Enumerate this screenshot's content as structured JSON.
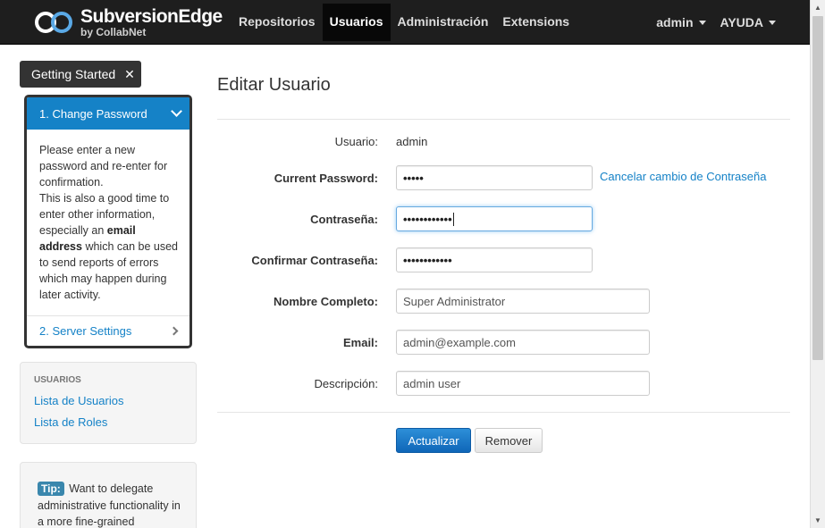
{
  "brand": {
    "title": "SubversionEdge",
    "subtitle": "by CollabNet"
  },
  "nav": {
    "links": [
      "Repositorios",
      "Usuarios",
      "Administración",
      "Extensions"
    ],
    "active": "Usuarios",
    "user_menu": "admin",
    "help_menu": "AYUDA"
  },
  "getting_started": {
    "button": "Getting Started",
    "close": "✕",
    "step1": "1. Change Password",
    "body_1": "Please enter a new password and re-enter for confirmation.",
    "body_2": "This is also a good time to enter other information, especially an",
    "body_bold": "email address",
    "body_3": "which can be used to send reports of errors which may happen during later activity.",
    "step2": "2. Server Settings"
  },
  "side_menu": {
    "heading": "USUARIOS",
    "items": [
      "Lista de Usuarios",
      "Lista de Roles"
    ]
  },
  "tip": {
    "label": "Tip:",
    "text": "Want to delegate administrative functionality in a more fine-grained"
  },
  "form": {
    "title": "Editar Usuario",
    "username_label": "Usuario:",
    "username_value": "admin",
    "current_password_label": "Current Password:",
    "current_password_value": "•••••",
    "cancel_link": "Cancelar cambio de Contraseña",
    "password_label": "Contraseña:",
    "password_value": "••••••••••••",
    "confirm_label": "Confirmar Contraseña:",
    "confirm_value": "••••••••••••",
    "fullname_label": "Nombre Completo:",
    "fullname_value": "Super Administrator",
    "email_label": "Email:",
    "email_value": "admin@example.com",
    "description_label": "Descripción:",
    "description_value": "admin user",
    "update_button": "Actualizar",
    "remove_button": "Remover"
  },
  "colors": {
    "navbar": "#1e1e1e",
    "accent": "#1582c7",
    "primary_button": "#0f66b8"
  }
}
